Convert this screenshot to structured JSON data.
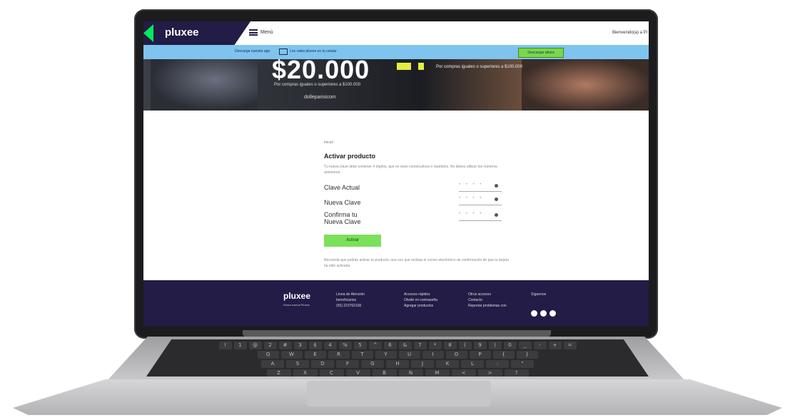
{
  "nav": {
    "logo": "pluxee",
    "menu_label": "Menú",
    "welcome": "Bienvenido(a) a Pl"
  },
  "infobar": {
    "text_left": "Descarga nuestra app",
    "text_right": "Los vales pluxee en tu celular",
    "button": "Descargar ahora"
  },
  "hero": {
    "amount": "$20.000",
    "sub": "Por compras iguales o superiores a $100.000",
    "site": "dolleparisicom",
    "right_text": "Por compras iguales o superiores a $100.000"
  },
  "form": {
    "breadcrumb": "Inicio/",
    "title": "Activar producto",
    "description": "Tu nueva clave debe contener 4 dígitos, que no sean consecutivos o repetidos. No debes utilizar los números anteriores.",
    "field1": "Clave Actual",
    "field2": "Nueva Clave",
    "field3": "Confirma tu Nueva Clave",
    "pin_placeholder": "• • • •",
    "button": "Activar",
    "note": "Recuerda que podrás activar tu producto, una vez que recibas el correo electrónico de confirmación de que tu tarjeta ha sido activada."
  },
  "footer": {
    "logo": "pluxee",
    "tagline": "Ahora somos Pluxee",
    "col1": [
      "Línea de Atención",
      "beneficiarios",
      "(56) 223762100"
    ],
    "col2": [
      "Accesos rápidos",
      "Olvidé mi contraseña",
      "Agregar productos"
    ],
    "col3": [
      "Otros accesos",
      "Contacto",
      "Reportar problemas con"
    ],
    "col4": [
      "Síguenos"
    ]
  },
  "keyboard": {
    "row1": [
      "!",
      "1",
      "@",
      "2",
      "#",
      "3",
      "$",
      "4",
      "%",
      "5",
      "^",
      "6",
      "&",
      "7",
      "*",
      "8",
      "(",
      "9",
      ")",
      "0",
      "_",
      "-",
      "+",
      "="
    ],
    "row2": [
      "Q",
      "W",
      "E",
      "R",
      "T",
      "Y",
      "U",
      "I",
      "O",
      "P",
      "{",
      "}"
    ],
    "row3": [
      "A",
      "S",
      "D",
      "F",
      "G",
      "H",
      "J",
      "K",
      "L",
      ":",
      "\""
    ],
    "row4": [
      "Z",
      "X",
      "C",
      "V",
      "B",
      "N",
      "M",
      "<",
      ">",
      "?"
    ]
  }
}
